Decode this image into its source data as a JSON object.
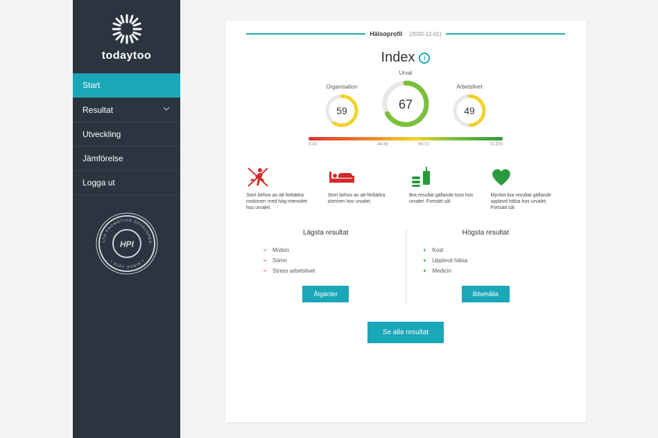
{
  "brand": "todaytoo",
  "sidebar": {
    "items": [
      {
        "label": "Start",
        "active": true
      },
      {
        "label": "Resultat",
        "expandable": true
      },
      {
        "label": "Utveckling"
      },
      {
        "label": "Jämförelse"
      },
      {
        "label": "Logga ut"
      }
    ],
    "badge": {
      "org": "HPI",
      "top": "HEALTH PROMOTION DEVELOPED BY",
      "bottom": "• SINCE 1976 •"
    }
  },
  "header": {
    "title": "Hälsoprofil",
    "date": "(2020-12-01)"
  },
  "index": {
    "title": "Index",
    "gauges": [
      {
        "label": "Organisation",
        "value": 59,
        "color": "#f3d22a"
      },
      {
        "label": "Urval",
        "value": 67,
        "color": "#7bbf3c",
        "big": true
      },
      {
        "label": "Arbetslivet",
        "value": 49,
        "color": "#f3d22a"
      }
    ],
    "scale": {
      "ticks": [
        "0-43",
        "",
        "44-59",
        "60-71",
        "",
        "72-100"
      ]
    }
  },
  "tiles": [
    {
      "icon": "runner-crossed",
      "color": "#d12d2d",
      "text": "Stort behov av att förbättra motionen med hög intensitet hos urvalet."
    },
    {
      "icon": "bed",
      "color": "#d12d2d",
      "text": "Stort behov av att förbättra sömnen hos urvalet."
    },
    {
      "icon": "food",
      "color": "#2a9b3b",
      "text": "Bra resultat gällande kost hos urvalet. Fortsätt så!"
    },
    {
      "icon": "heart",
      "color": "#2a9b3b",
      "text": "Mycket bra resultat gällande upplevd hälsa hos urvalet. Fortsätt så!"
    }
  ],
  "results": {
    "low": {
      "title": "Lägsta resultat",
      "items": [
        "Motion",
        "Sömn",
        "Stress arbetslivet"
      ],
      "button": "Åtgärder"
    },
    "high": {
      "title": "Högsta resultat",
      "items": [
        "Kost",
        "Upplevd hälsa",
        "Medicin"
      ],
      "button": "Bibehålla"
    }
  },
  "allButton": "Se alla resultat",
  "chart_data": {
    "type": "bar",
    "title": "Index",
    "categories": [
      "Organisation",
      "Urval",
      "Arbetslivet"
    ],
    "values": [
      59,
      67,
      49
    ],
    "ylim": [
      0,
      100
    ],
    "scale_segments": [
      [
        0,
        43
      ],
      [
        44,
        59
      ],
      [
        60,
        71
      ],
      [
        72,
        100
      ]
    ]
  }
}
